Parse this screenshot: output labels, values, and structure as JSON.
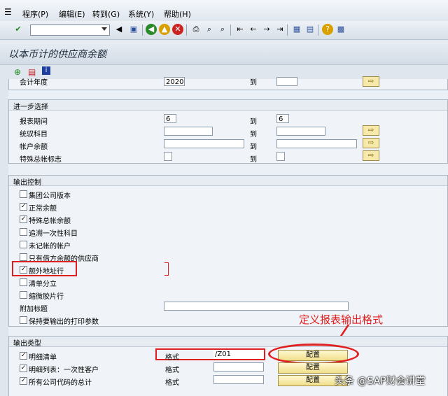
{
  "menu": {
    "items": [
      "程序(P)",
      "编辑(E)",
      "转到(G)",
      "系统(Y)",
      "帮助(H)"
    ]
  },
  "toolbar": {
    "command_value": "",
    "icons": [
      "check-icon",
      "save-icon",
      "back-icon",
      "exit-icon",
      "cancel-icon",
      "print-icon",
      "find-icon",
      "find-next-icon",
      "first-page-icon",
      "prev-page-icon",
      "next-page-icon",
      "last-page-icon",
      "create-session-icon",
      "shortcut-icon",
      "help-icon",
      "layout-icon"
    ]
  },
  "title": "以本币计的供应商余额",
  "top_partial": {
    "label": "会计年度",
    "value": "2020",
    "to": "到"
  },
  "further_selection": {
    "header": "进一步选择",
    "rows": [
      {
        "label": "报表期间",
        "from": "6",
        "to_label": "到",
        "to": "6"
      },
      {
        "label": "统驭科目",
        "from": "",
        "to_label": "到",
        "to": ""
      },
      {
        "label": "帐户余额",
        "from": "",
        "to_label": "到",
        "to": ""
      },
      {
        "label": "特殊总帐标志",
        "from": "",
        "to_label": "到",
        "to": ""
      }
    ]
  },
  "output_control": {
    "header": "输出控制",
    "options": [
      {
        "label": "集团公司版本",
        "checked": false
      },
      {
        "label": "正常余额",
        "checked": true
      },
      {
        "label": "特殊总帐余额",
        "checked": true
      },
      {
        "label": "追溯一次性科目",
        "checked": false
      },
      {
        "label": "未记帐的帐户",
        "checked": false
      },
      {
        "label": "只有借方余额的供应商",
        "checked": false
      },
      {
        "label": "额外地址行",
        "checked": true
      },
      {
        "label": "清单分立",
        "checked": false
      },
      {
        "label": "缩微胶片行",
        "checked": false
      }
    ],
    "additional_title_label": "附加标题",
    "additional_title_value": "",
    "keep_print_params": {
      "label": "保持要输出的打印参数",
      "checked": false
    }
  },
  "annotation": "定义报表输出格式",
  "output_type": {
    "header": "输出类型",
    "rows": [
      {
        "label": "明细清单",
        "checked": true,
        "format_label": "格式",
        "format": "/Z01",
        "button": "配置"
      },
      {
        "label": "明细列表：一次性客户",
        "checked": true,
        "format_label": "格式",
        "format": "",
        "button": "配置"
      },
      {
        "label": "所有公司代码的总计",
        "checked": true,
        "format_label": "格式",
        "format": "",
        "button": "配置"
      }
    ]
  },
  "watermark": "头条 @SAP财会讲堂",
  "check_mark": "✓",
  "colors": {
    "accent_red": "#e02020",
    "annotation_red": "#e02020"
  }
}
